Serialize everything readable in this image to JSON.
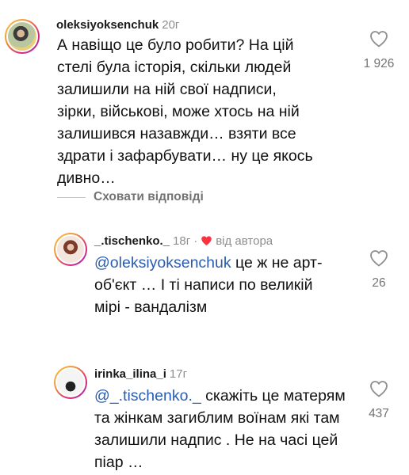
{
  "comments": [
    {
      "username": "oleksiyoksenchuk",
      "time": "20г",
      "text": "А навіщо це було робити? На цій стелі була історія, скільки людей залишили на ній свої надписи, зірки, військові, може хтось на ній залишився назавжди… взяти все здрати і зафарбувати… ну це якось дивно…",
      "likes": "1 926",
      "avatar_icon": "profile-photo"
    },
    {
      "username": "_.tischenko._",
      "time": "18г",
      "separator": "·",
      "author_label": "від автора",
      "author_heart_color": "#ff3040",
      "mention": "@oleksiyoksenchuk",
      "text": " це ж не арт-об'єкт … І ті написи по великій мірі - вандалізм",
      "likes": "26",
      "avatar_icon": "profile-photo"
    },
    {
      "username": "irinka_ilina_i",
      "time": "17г",
      "mention": "@_.tischenko._",
      "text": " скажіть це матерям та жінкам загиблим воїнам які там залишили надпис . Не на часі цей піар …",
      "likes": "437",
      "avatar_icon": "profile-photo"
    }
  ],
  "hide_replies": "Сховати відповіді",
  "colors": {
    "mention": "#2a5db0",
    "secondary_text": "#737373",
    "heart_red": "#ff3040"
  }
}
